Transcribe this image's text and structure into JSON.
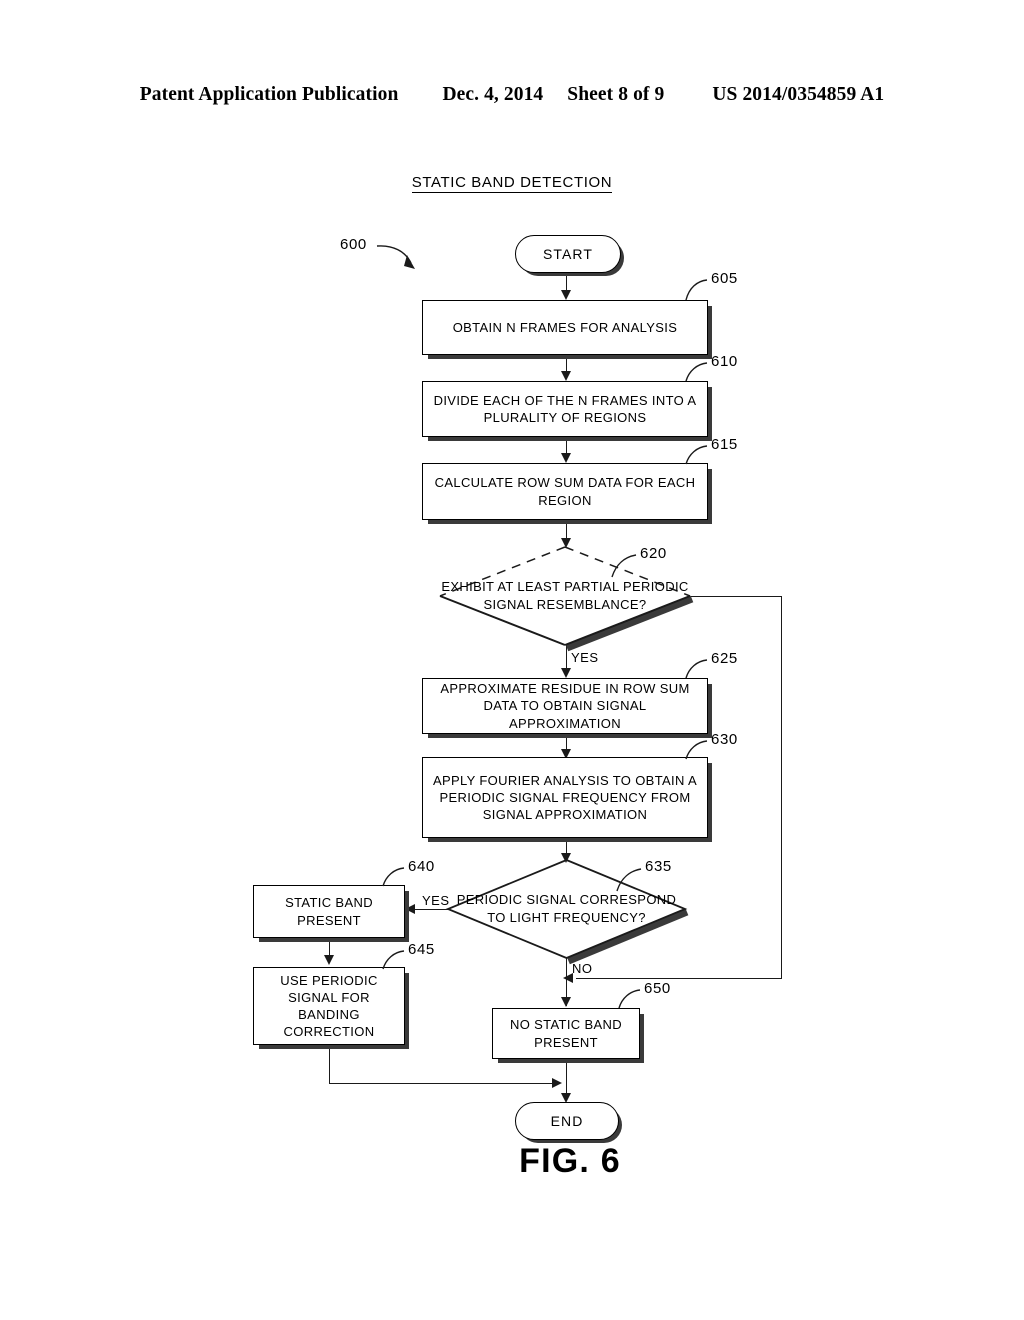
{
  "header": {
    "publication": "Patent Application Publication",
    "date": "Dec. 4, 2014",
    "sheet": "Sheet 8 of 9",
    "number": "US 2014/0354859 A1"
  },
  "figure": {
    "title": "STATIC BAND DETECTION",
    "caption": "FIG. 6",
    "flow_ref": "600"
  },
  "nodes": {
    "start": {
      "label": "START",
      "ref": ""
    },
    "n605": {
      "label": "OBTAIN N FRAMES FOR ANALYSIS",
      "ref": "605"
    },
    "n610": {
      "label": "DIVIDE EACH OF THE N FRAMES INTO A PLURALITY OF REGIONS",
      "ref": "610"
    },
    "n615": {
      "label": "CALCULATE ROW SUM DATA FOR EACH REGION",
      "ref": "615"
    },
    "n620": {
      "label": "EXHIBIT AT LEAST PARTIAL PERIODIC SIGNAL RESEMBLANCE?",
      "ref": "620"
    },
    "n625": {
      "label": "APPROXIMATE RESIDUE IN ROW SUM DATA TO OBTAIN SIGNAL APPROXIMATION",
      "ref": "625"
    },
    "n630": {
      "label": "APPLY FOURIER ANALYSIS TO OBTAIN A PERIODIC SIGNAL FREQUENCY FROM SIGNAL APPROXIMATION",
      "ref": "630"
    },
    "n635": {
      "label": "PERIODIC SIGNAL CORRESPOND TO LIGHT FREQUENCY?",
      "ref": "635"
    },
    "n640": {
      "label": "STATIC BAND PRESENT",
      "ref": "640"
    },
    "n645": {
      "label": "USE PERIODIC SIGNAL FOR BANDING CORRECTION",
      "ref": "645"
    },
    "n650": {
      "label": "NO STATIC BAND PRESENT",
      "ref": "650"
    },
    "end": {
      "label": "END",
      "ref": ""
    }
  },
  "branches": {
    "yes_620": "YES",
    "yes_635": "YES",
    "no_635": "NO"
  },
  "colors": {
    "ink": "#000000",
    "shadow": "#3a3a3a",
    "paper": "#ffffff"
  }
}
